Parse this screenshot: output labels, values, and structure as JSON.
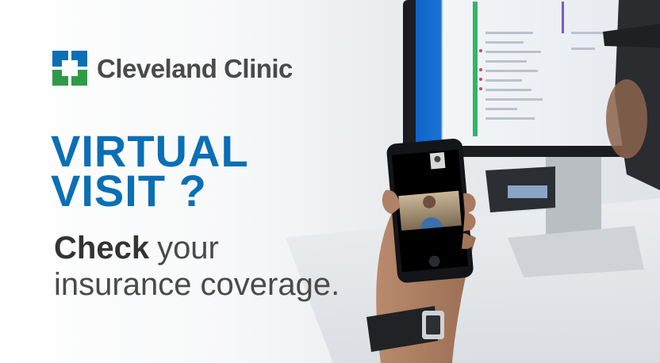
{
  "brand": {
    "name": "Cleveland Clinic",
    "logo_colors": [
      "#0a6fb5",
      "#2e9b48"
    ]
  },
  "headline": {
    "line1": "VIRTUAL",
    "line2": "VISIT ?",
    "color": "#0a6fb5"
  },
  "subhead": {
    "bold": "Check",
    "rest": "your",
    "line2": "insurance coverage."
  },
  "photo": {
    "subject": "hand holding smartphone on video call in front of computer monitor",
    "icons": [
      "smartphone-icon",
      "monitor-icon",
      "wristwatch-icon"
    ]
  }
}
